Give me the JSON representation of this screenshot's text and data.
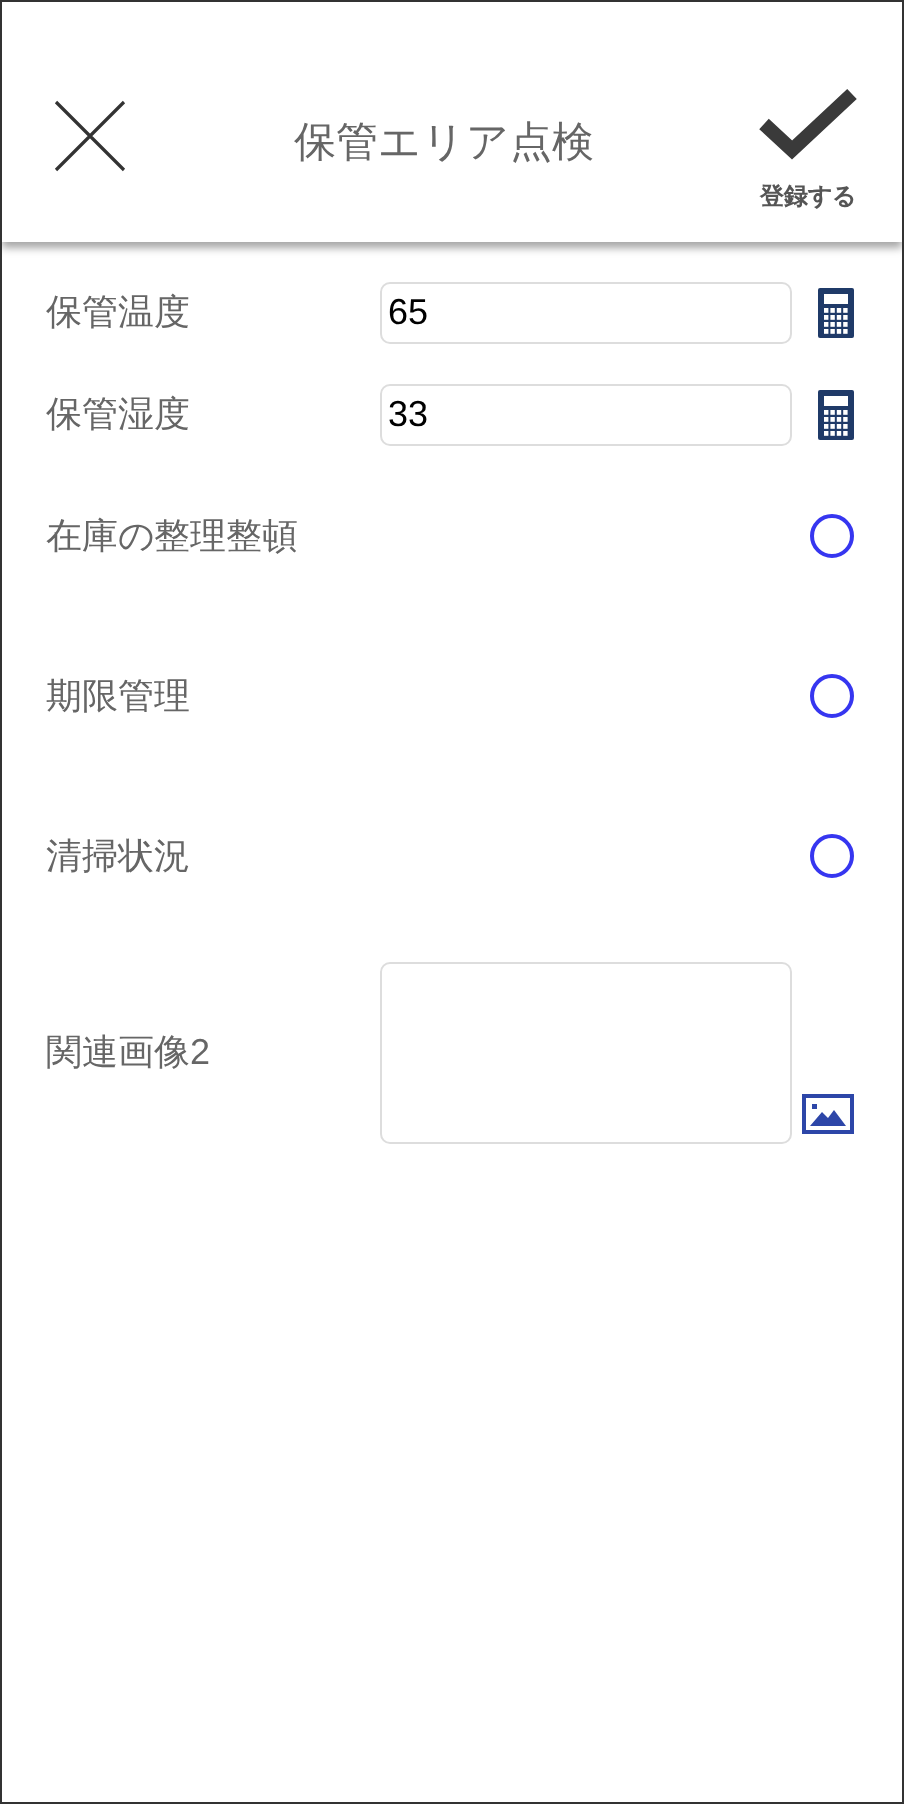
{
  "header": {
    "title": "保管エリア点検",
    "submit_label": "登録する"
  },
  "fields": [
    {
      "kind": "number",
      "label": "保管温度",
      "value": "65"
    },
    {
      "kind": "number",
      "label": "保管湿度",
      "value": "33"
    },
    {
      "kind": "check",
      "label": "在庫の整理整頓",
      "checked": false
    },
    {
      "kind": "check",
      "label": "期限管理",
      "checked": false
    },
    {
      "kind": "check",
      "label": "清掃状況",
      "checked": false
    },
    {
      "kind": "image",
      "label": "関連画像2"
    }
  ]
}
